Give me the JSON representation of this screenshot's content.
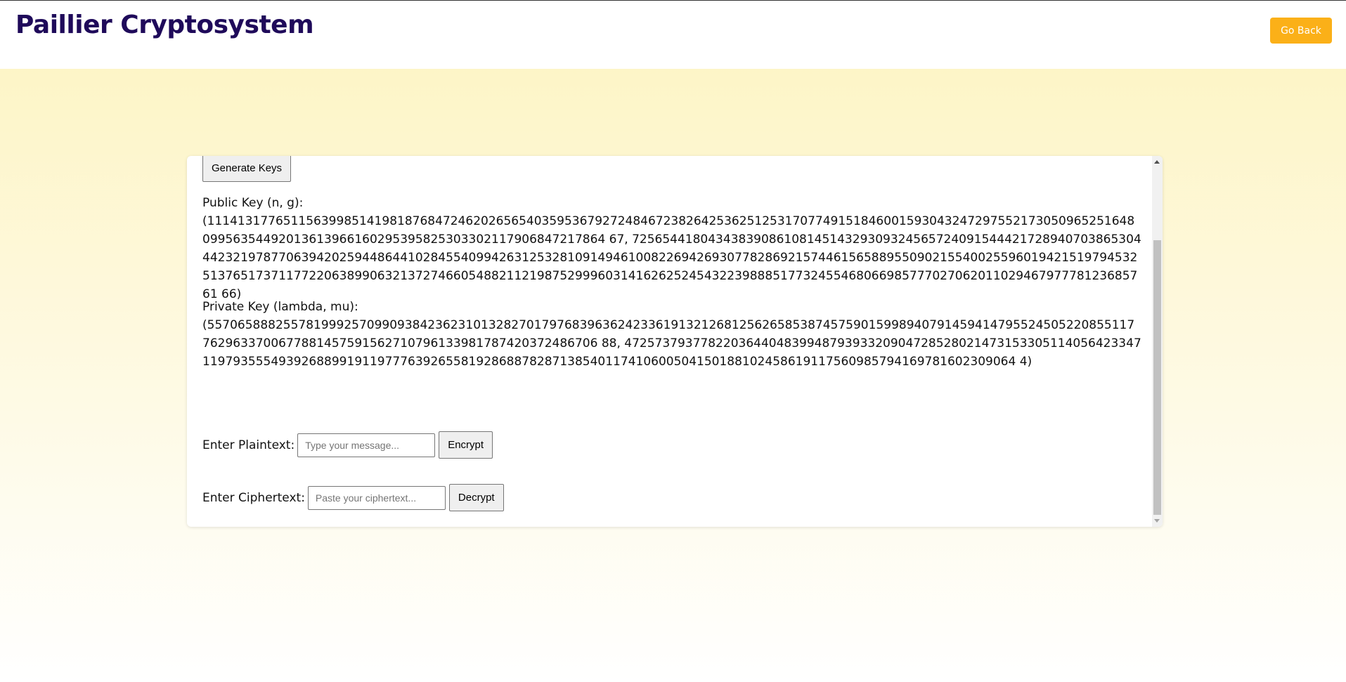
{
  "header": {
    "title": "Paillier Cryptosystem",
    "go_back_label": "Go Back"
  },
  "keys": {
    "generate_label": "Generate Keys",
    "public_label": "Public Key (n, g):",
    "public_value": "(1114131776511563998514198187684724620265654035953679272484672382642536251253170774915184600159304324729755217305096525164809956354492013613966160295395825303302117906847217864 67, 725654418043438390861081451432930932456572409154442172894070386530444232197877063942025944864410284554099426312532810914946100822694269307782869215744615658895509021554002559601942151979453251376517371177220638990632137274660548821121987529996031416262524543223988851773245546806698577702706201102946797778123685761 66)",
    "private_label": "Private Key (lambda, mu):",
    "private_value": "(557065888255781999257099093842362310132827017976839636242336191321268125626585387457590159989407914594147955245052208551177629633700677881457591562710796133981787420372486706 88, 4725737937782203644048399487939332090472852802147315330511405642334711979355549392688991911977763926558192868878287138540117410600504150188102458619117560985794169781602309064 4)"
  },
  "encrypt": {
    "label": "Enter Plaintext:",
    "placeholder": "Type your message...",
    "button_label": "Encrypt"
  },
  "decrypt": {
    "label": "Enter Ciphertext:",
    "placeholder": "Paste your ciphertext...",
    "button_label": "Decrypt"
  },
  "colors": {
    "title": "#1f0a5a",
    "accent": "#fbb018",
    "background_top": "#fdf5c7"
  }
}
